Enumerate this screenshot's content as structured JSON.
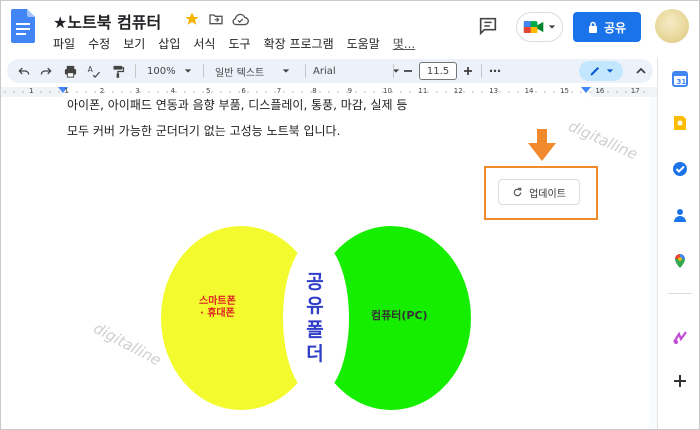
{
  "header": {
    "doc_title": "★노트북 컴퓨터",
    "menu": [
      "파일",
      "수정",
      "보기",
      "삽입",
      "서식",
      "도구",
      "확장 프로그램",
      "도움말",
      "몇..."
    ],
    "share_label": "공유"
  },
  "toolbar": {
    "zoom": "100%",
    "style": "일반 텍스트",
    "font": "Arial",
    "font_size": "11.5",
    "more": "⋯"
  },
  "ruler": {
    "ticks": [
      "1",
      "1",
      "2",
      "3",
      "4",
      "5",
      "6",
      "7",
      "8",
      "9",
      "10",
      "11",
      "12",
      "13",
      "14",
      "15",
      "16",
      "17"
    ]
  },
  "document": {
    "line1": "아이폰, 아이패드 연동과 음향 부품, 디스플레이, 통풍, 마감, 실제 등",
    "line2": "모두 커버 가능한 군더더기 없는 고성능 노트북 입니다."
  },
  "update_button": {
    "label": "업데이트"
  },
  "venn": {
    "left_label_line1": "스마트폰",
    "left_label_line2": "· 휴대폰",
    "center_chars": [
      "공",
      "유",
      "폴",
      "더"
    ],
    "right_label": "컴퓨터(PC)",
    "colors": {
      "left": "#f3fb2e",
      "right": "#16ee00",
      "center_text": "#2f3ec7"
    }
  },
  "watermarks": [
    "digitalline",
    "digitalline"
  ],
  "colors": {
    "accent": "#1a73e8",
    "highlight_box": "#f08a2c",
    "toolbar_bg": "#edf2fa"
  }
}
